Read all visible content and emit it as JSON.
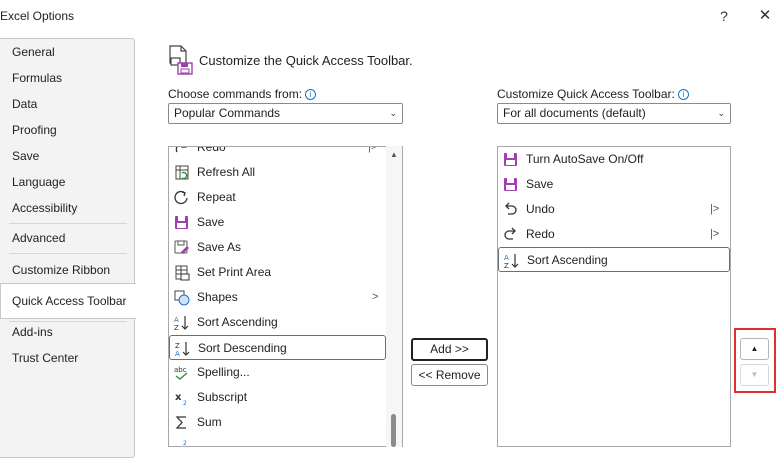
{
  "window": {
    "title": "Excel Options",
    "help_glyph": "?",
    "close_glyph": "✕"
  },
  "sidebar": {
    "items": [
      {
        "label": "General"
      },
      {
        "label": "Formulas"
      },
      {
        "label": "Data"
      },
      {
        "label": "Proofing"
      },
      {
        "label": "Save"
      },
      {
        "label": "Language"
      },
      {
        "label": "Accessibility"
      },
      {
        "label": "Advanced"
      },
      {
        "label": "Customize Ribbon"
      },
      {
        "label": "Quick Access Toolbar"
      },
      {
        "label": "Add-ins"
      },
      {
        "label": "Trust Center"
      }
    ],
    "selected": "Quick Access Toolbar"
  },
  "main": {
    "heading": "Customize the Quick Access Toolbar.",
    "choose_label": "Choose commands from:",
    "choose_value": "Popular Commands",
    "customize_label": "Customize Quick Access Toolbar:",
    "customize_value": "For all documents (default)",
    "info_glyph": "i"
  },
  "commands_list": [
    {
      "label": "Redo",
      "icon": "redo-icon"
    },
    {
      "label": "Refresh All",
      "icon": "refresh-all-icon"
    },
    {
      "label": "Repeat",
      "icon": "repeat-icon"
    },
    {
      "label": "Save",
      "icon": "save-icon"
    },
    {
      "label": "Save As",
      "icon": "save-as-icon"
    },
    {
      "label": "Set Print Area",
      "icon": "print-area-icon"
    },
    {
      "label": "Shapes",
      "icon": "shapes-icon"
    },
    {
      "label": "Sort Ascending",
      "icon": "sort-ascending-icon"
    },
    {
      "label": "Sort Descending",
      "icon": "sort-descending-icon"
    },
    {
      "label": "Spelling...",
      "icon": "spelling-icon"
    },
    {
      "label": "Subscript",
      "icon": "subscript-icon"
    },
    {
      "label": "Sum",
      "icon": "sum-icon"
    }
  ],
  "toolbar_list": [
    {
      "label": "Turn AutoSave On/Off",
      "icon": "autosave-icon"
    },
    {
      "label": "Save",
      "icon": "save-icon"
    },
    {
      "label": "Undo",
      "icon": "undo-icon"
    },
    {
      "label": "Redo",
      "icon": "redo-icon"
    },
    {
      "label": "Sort Ascending",
      "icon": "sort-ascending-icon"
    }
  ],
  "buttons": {
    "add": "Add >>",
    "remove": "<< Remove"
  },
  "arrows": {
    "submenu": ">",
    "separator_submenu": "|>",
    "move_up": "▲",
    "move_down": "▼",
    "dropdown": "⌄"
  },
  "colors": {
    "accent_purple": "#a23fb0",
    "highlight_red": "#e03131",
    "info_blue": "#1a73c7"
  }
}
